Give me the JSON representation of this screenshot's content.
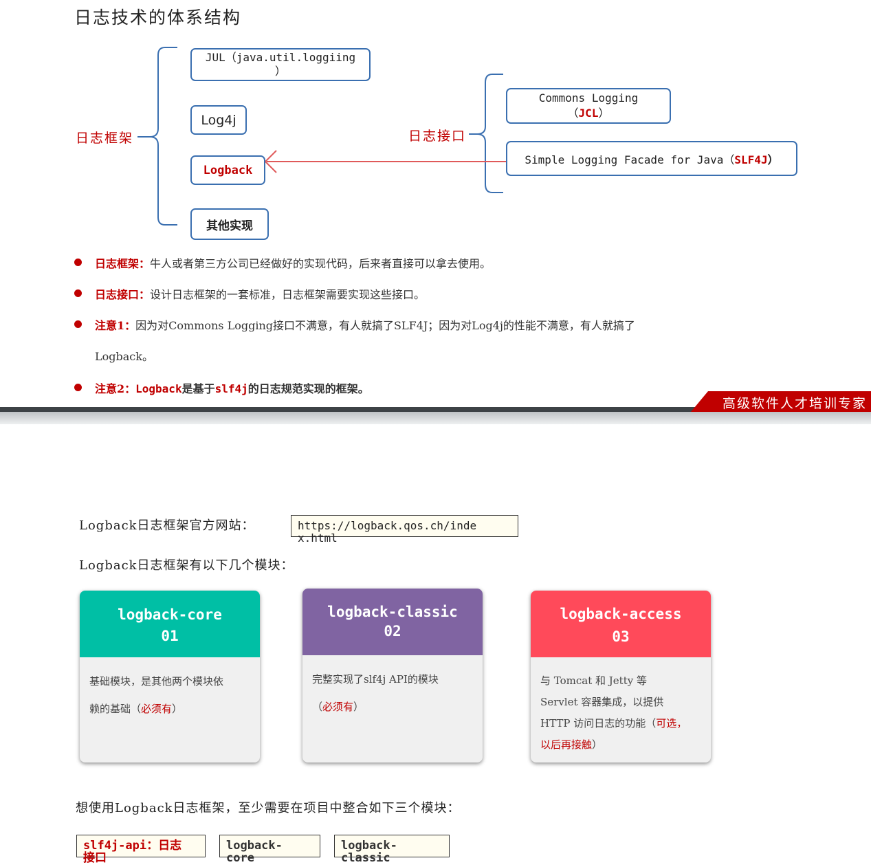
{
  "page_title": "日志技术的体系结构",
  "diagram": {
    "framework_label": "日志框架",
    "interface_label": "日志接口",
    "frameworks": [
      {
        "line1": "JUL（java.util.loggiing",
        "line2": "）"
      },
      {
        "label": "Log4j"
      },
      {
        "label": "Logback"
      },
      {
        "label": "其他实现"
      }
    ],
    "interfaces": [
      {
        "line1": "Commons Logging",
        "line2_open": "（",
        "line2_abbr": "JCL",
        "line2_close": "）"
      },
      {
        "text": "Simple Logging Facade for Java（",
        "abbr": "SLF4J",
        "close": "）"
      }
    ]
  },
  "bullets": [
    {
      "label": "日志框架：",
      "text": "牛人或者第三方公司已经做好的实现代码，后来者直接可以拿去使用。"
    },
    {
      "label": "日志接口：",
      "text": "设计日志框架的一套标准，日志框架需要实现这些接口。"
    },
    {
      "label": "注意1：",
      "text": "因为对Commons Logging接口不满意，有人就搞了SLF4J；因为对Log4j的性能不满意，有人就搞了",
      "text2": "Logback。"
    },
    {
      "label": "注意2：",
      "part1": "Logback",
      "part2": "是基于",
      "part3": "slf4j",
      "part4": "的日志规范实现的框架。"
    }
  ],
  "banner": "高级软件人才培训专家",
  "site": {
    "label": "Logback日志框架官方网站：",
    "url_line1": "https://logback.qos.ch/inde",
    "url_line2": "x.html"
  },
  "modules_heading": "Logback日志框架有以下几个模块：",
  "modules": [
    {
      "name": "logback-core",
      "num": "01",
      "color": "#00bfa5",
      "desc": "基础模块，是其他两个模块依",
      "desc2": "赖的基础（",
      "req": "必须有",
      "close": "）"
    },
    {
      "name": "logback-classic",
      "num": "02",
      "color": "#8064a2",
      "desc": "完整实现了slf4j API的模块",
      "desc2": "（",
      "req": "必须有",
      "close": "）"
    },
    {
      "name": "logback-access",
      "num": "03",
      "color": "#ff4a5a",
      "desc": "与 Tomcat 和 Jetty 等",
      "desc2": "Servlet 容器集成，以提供",
      "desc3": "HTTP 访问日志的功能（",
      "req": "可选，",
      "desc4": "以后再接触",
      "close": "）"
    }
  ],
  "integrate_heading": "想使用Logback日志框架，至少需要在项目中整合如下三个模块：",
  "required_modules": [
    {
      "line1": "slf4j-api：日志",
      "line2": "接口"
    },
    {
      "line1": "logback-",
      "line2": "core"
    },
    {
      "line1": "logback-",
      "line2": "classic"
    }
  ],
  "colors": {
    "accent_red": "#c00000",
    "box_blue": "#3a6fb0",
    "arrow_red": "#e05a5a"
  }
}
